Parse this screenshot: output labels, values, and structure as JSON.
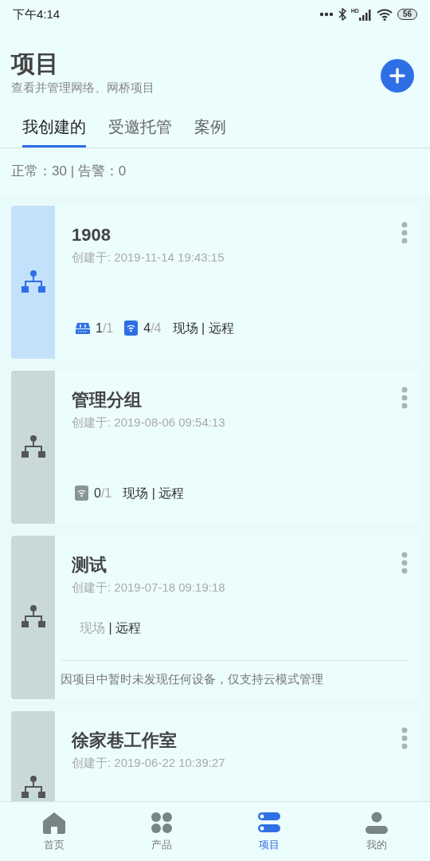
{
  "status_bar": {
    "time": "下午4:14",
    "network": "HD",
    "battery": "56"
  },
  "header": {
    "title": "项目",
    "subtitle": "查看并管理网络、网桥项目"
  },
  "tabs": [
    {
      "label": "我创建的",
      "selected": true
    },
    {
      "label": "受邀托管",
      "selected": false
    },
    {
      "label": "案例",
      "selected": false
    }
  ],
  "summary": "正常：30 | 告警：0",
  "projects": [
    {
      "name": "1908",
      "created": "创建于: 2019-11-14 19:43:15",
      "selected": true,
      "devices": [
        {
          "kind": "switch",
          "online": "1",
          "total": "/1",
          "active": true
        },
        {
          "kind": "ap",
          "online": "4",
          "total": "/4",
          "active": true
        }
      ],
      "modes": [
        {
          "label": "现场",
          "active": true
        },
        {
          "label": "| 远程",
          "active": true
        }
      ]
    },
    {
      "name": "管理分组",
      "created": "创建于: 2019-08-06 09:54:13",
      "selected": false,
      "devices": [
        {
          "kind": "ap",
          "online": "0",
          "total": "/1",
          "active": false
        }
      ],
      "modes": [
        {
          "label": "现场",
          "active": true
        },
        {
          "label": "| 远程",
          "active": true
        }
      ]
    },
    {
      "name": "测试",
      "created": "创建于: 2019-07-18 09:19:18",
      "selected": false,
      "modes": [
        {
          "label": "现场",
          "active": false
        },
        {
          "label": "| 远程",
          "active": true
        }
      ],
      "note": "因项目中暂时未发现任何设备，仅支持云模式管理"
    },
    {
      "name": "徐家巷工作室",
      "created": "创建于: 2019-06-22 10:39:27",
      "selected": false
    }
  ],
  "nav": [
    {
      "label": "首页",
      "kind": "home",
      "selected": false
    },
    {
      "label": "产品",
      "kind": "products",
      "selected": false
    },
    {
      "label": "项目",
      "kind": "projects",
      "selected": true
    },
    {
      "label": "我的",
      "kind": "me",
      "selected": false
    }
  ]
}
